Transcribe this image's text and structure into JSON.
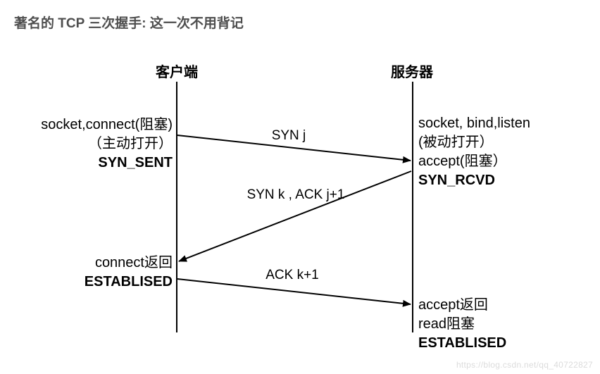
{
  "title": "著名的 TCP 三次握手: 这一次不用背记",
  "diagram": {
    "client_header": "客户端",
    "server_header": "服务器",
    "client_step1_line1": "socket,connect(阻塞)",
    "client_step1_line2": "（主动打开）",
    "client_step1_state": "SYN_SENT",
    "server_step1_line1": "socket, bind,listen",
    "server_step1_line2": "(被动打开）",
    "server_step1_line3": "accept(阻塞）",
    "server_step1_state": "SYN_RCVD",
    "client_step2_line1": "connect返回",
    "client_step2_state": "ESTABLISED",
    "server_step2_line1": "accept返回",
    "server_step2_line2": "read阻塞",
    "server_step2_state": "ESTABLISED",
    "msg1": "SYN j",
    "msg2": "SYN k , ACK j+1",
    "msg3": "ACK k+1"
  },
  "watermark": "https://blog.csdn.net/qq_40722827"
}
